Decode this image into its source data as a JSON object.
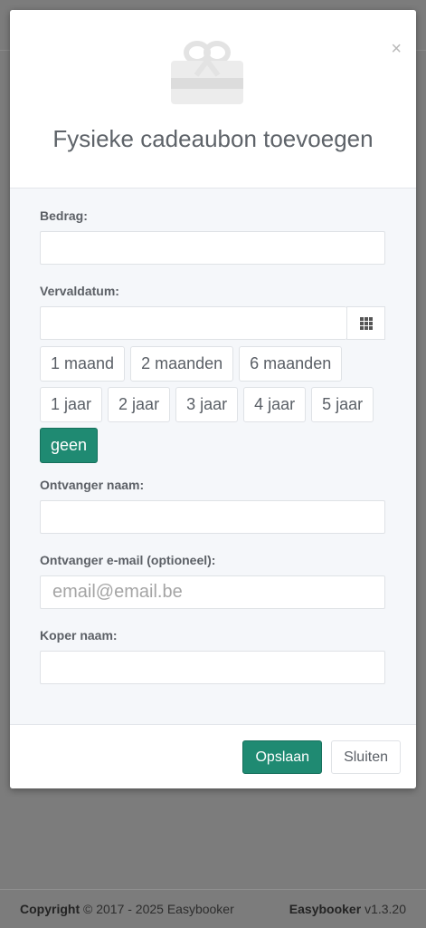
{
  "modal": {
    "title": "Fysieke cadeaubon toevoegen",
    "close_symbol": "×",
    "header_icon": "gift-icon"
  },
  "form": {
    "amount_label": "Bedrag:",
    "amount_value": "",
    "expiry_label": "Vervaldatum:",
    "expiry_value": "",
    "calendar_icon": "calendar-grid-icon",
    "expiry_options": [
      {
        "label": "1 maand",
        "active": false
      },
      {
        "label": "2 maanden",
        "active": false
      },
      {
        "label": "6 maanden",
        "active": false
      },
      {
        "label": "1 jaar",
        "active": false
      },
      {
        "label": "2 jaar",
        "active": false
      },
      {
        "label": "3 jaar",
        "active": false
      },
      {
        "label": "4 jaar",
        "active": false
      },
      {
        "label": "5 jaar",
        "active": false
      },
      {
        "label": "geen",
        "active": true
      }
    ],
    "recipient_name_label": "Ontvanger naam:",
    "recipient_name_value": "",
    "recipient_email_label": "Ontvanger e-mail (optioneel):",
    "recipient_email_placeholder": "email@email.be",
    "buyer_name_label": "Koper naam:",
    "buyer_name_value": ""
  },
  "buttons": {
    "save": "Opslaan",
    "close": "Sluiten"
  },
  "footer": {
    "copyright_label": "Copyright",
    "copyright_text": "© 2017 - 2025 Easybooker",
    "app_name": "Easybooker",
    "version": "v1.3.20"
  },
  "colors": {
    "primary": "#1f8a72",
    "overlay": "#7c7c7c",
    "body_bg": "#f5f7fa"
  }
}
